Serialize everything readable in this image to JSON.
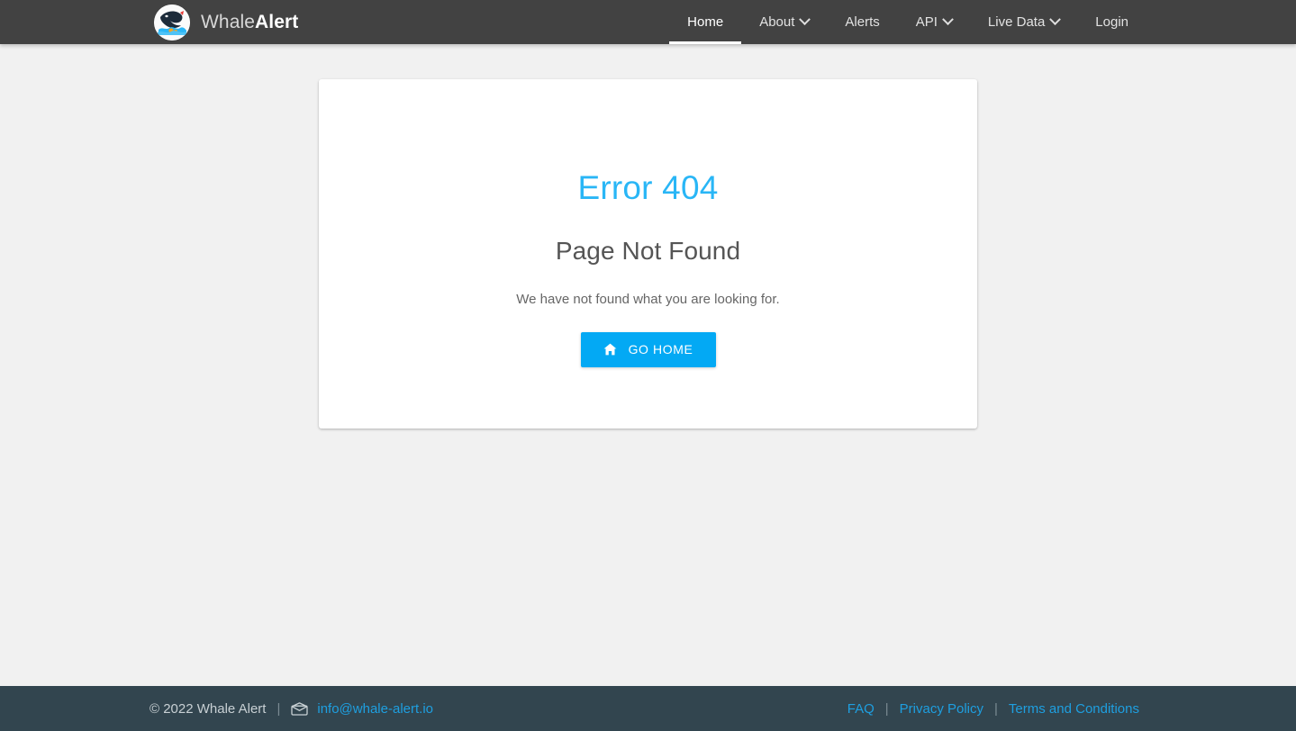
{
  "colors": {
    "navbar_bg": "#424242",
    "page_bg": "#f1f1f1",
    "card_bg": "#ffffff",
    "accent_blue": "#03a9f4",
    "title_blue": "#29b6f6",
    "footer_bg": "#32454f",
    "footer_link": "#1e9fe0"
  },
  "navbar": {
    "brand": {
      "logo_icon": "whale-logo-icon",
      "name_light": "Whale",
      "name_bold": "Alert"
    },
    "items": [
      {
        "label": "Home",
        "has_dropdown": false,
        "active": true
      },
      {
        "label": "About",
        "has_dropdown": true,
        "active": false
      },
      {
        "label": "Alerts",
        "has_dropdown": false,
        "active": false
      },
      {
        "label": "API",
        "has_dropdown": true,
        "active": false
      },
      {
        "label": "Live Data",
        "has_dropdown": true,
        "active": false
      },
      {
        "label": "Login",
        "has_dropdown": false,
        "active": false
      }
    ]
  },
  "card": {
    "error_title": "Error 404",
    "subtitle": "Page Not Found",
    "description": "We have not found what you are looking for.",
    "button": {
      "label": "GO HOME",
      "icon": "home-icon"
    }
  },
  "footer": {
    "copyright": "© 2022 Whale Alert",
    "separator": "|",
    "email_icon": "mail-icon",
    "email": "info@whale-alert.io",
    "links": [
      {
        "label": "FAQ"
      },
      {
        "label": "Privacy Policy"
      },
      {
        "label": "Terms and Conditions"
      }
    ]
  }
}
